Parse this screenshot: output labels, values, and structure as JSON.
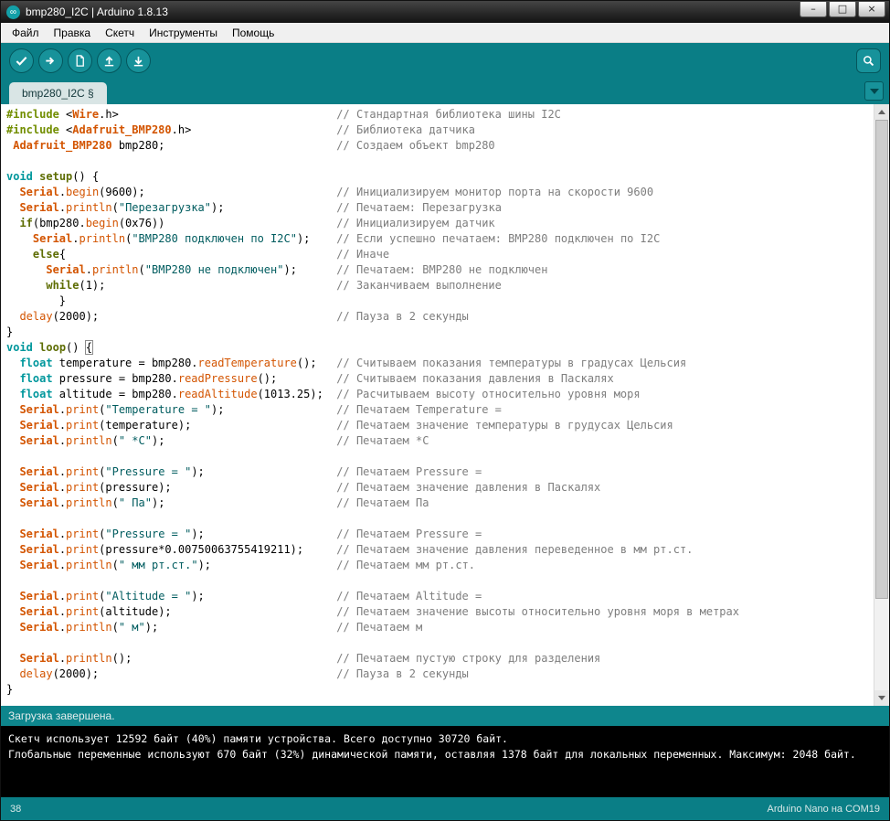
{
  "window": {
    "title": "bmp280_I2C | Arduino 1.8.13",
    "app_icon_glyph": "∞",
    "controls": {
      "minimize": "–",
      "maximize": "□",
      "close": "×"
    }
  },
  "menu": {
    "items": [
      {
        "name": "menu-file",
        "label": "Файл"
      },
      {
        "name": "menu-edit",
        "label": "Правка"
      },
      {
        "name": "menu-sketch",
        "label": "Скетч"
      },
      {
        "name": "menu-tools",
        "label": "Инструменты"
      },
      {
        "name": "menu-help",
        "label": "Помощь"
      }
    ]
  },
  "toolbar": {
    "buttons": [
      {
        "name": "verify-button",
        "icon": "check-icon"
      },
      {
        "name": "upload-button",
        "icon": "arrow-right-icon"
      },
      {
        "name": "new-sketch-button",
        "icon": "document-icon"
      },
      {
        "name": "open-button",
        "icon": "arrow-up-icon"
      },
      {
        "name": "save-button",
        "icon": "arrow-down-icon"
      }
    ],
    "serial_monitor": {
      "name": "serial-monitor-button",
      "icon": "magnifier-icon"
    }
  },
  "tabs": {
    "active_label": "bmp280_I2C §"
  },
  "editor": {
    "comment_column": 50,
    "lines": [
      {
        "seg": [
          [
            "pp",
            "#include"
          ],
          [
            "pl",
            " <"
          ],
          [
            "cls",
            "Wire"
          ],
          [
            "pl",
            ".h>"
          ]
        ],
        "cmt": "// Стандартная библиотека шины I2C"
      },
      {
        "seg": [
          [
            "pp",
            "#include"
          ],
          [
            "pl",
            " <"
          ],
          [
            "cls",
            "Adafruit_BMP280"
          ],
          [
            "pl",
            ".h>"
          ]
        ],
        "cmt": "// Библиотека датчика"
      },
      {
        "seg": [
          [
            "pl",
            " "
          ],
          [
            "cls",
            "Adafruit_BMP280"
          ],
          [
            "pl",
            " bmp280;"
          ]
        ],
        "cmt": "// Создаем объект bmp280"
      },
      {},
      {
        "seg": [
          [
            "kw",
            "void"
          ],
          [
            "pl",
            " "
          ],
          [
            "ctl",
            "setup"
          ],
          [
            "pl",
            "() {"
          ]
        ]
      },
      {
        "seg": [
          [
            "pl",
            "  "
          ],
          [
            "cls",
            "Serial"
          ],
          [
            "pl",
            "."
          ],
          [
            "fn",
            "begin"
          ],
          [
            "pl",
            "(9600);"
          ]
        ],
        "cmt": "// Инициализируем монитор порта на скорости 9600"
      },
      {
        "seg": [
          [
            "pl",
            "  "
          ],
          [
            "cls",
            "Serial"
          ],
          [
            "pl",
            "."
          ],
          [
            "fn",
            "println"
          ],
          [
            "pl",
            "("
          ],
          [
            "str",
            "\"Перезагрузка\""
          ],
          [
            "pl",
            ");"
          ]
        ],
        "cmt": "// Печатаем: Перезагрузка"
      },
      {
        "seg": [
          [
            "pl",
            "  "
          ],
          [
            "ctl",
            "if"
          ],
          [
            "pl",
            "(bmp280."
          ],
          [
            "fn",
            "begin"
          ],
          [
            "pl",
            "(0x76))"
          ]
        ],
        "cmt": "// Инициализируем датчик"
      },
      {
        "seg": [
          [
            "pl",
            "    "
          ],
          [
            "cls",
            "Serial"
          ],
          [
            "pl",
            "."
          ],
          [
            "fn",
            "println"
          ],
          [
            "pl",
            "("
          ],
          [
            "str",
            "\"BMP280 подключен по I2C\""
          ],
          [
            "pl",
            ");"
          ]
        ],
        "cmt": "// Если успешно печатаем: BMP280 подключен по I2C"
      },
      {
        "seg": [
          [
            "pl",
            "    "
          ],
          [
            "ctl",
            "else"
          ],
          [
            "pl",
            "{"
          ]
        ],
        "cmt": "// Иначе"
      },
      {
        "seg": [
          [
            "pl",
            "      "
          ],
          [
            "cls",
            "Serial"
          ],
          [
            "pl",
            "."
          ],
          [
            "fn",
            "println"
          ],
          [
            "pl",
            "("
          ],
          [
            "str",
            "\"BMP280 не подключен\""
          ],
          [
            "pl",
            ");"
          ]
        ],
        "cmt": "// Печатаем: BMP280 не подключен"
      },
      {
        "seg": [
          [
            "pl",
            "      "
          ],
          [
            "ctl",
            "while"
          ],
          [
            "pl",
            "(1);"
          ]
        ],
        "cmt": "// Заканчиваем выполнение"
      },
      {
        "seg": [
          [
            "pl",
            "        }"
          ]
        ]
      },
      {
        "seg": [
          [
            "pl",
            "  "
          ],
          [
            "fn",
            "delay"
          ],
          [
            "pl",
            "(2000);"
          ]
        ],
        "cmt": "// Пауза в 2 секунды"
      },
      {
        "seg": [
          [
            "pl",
            "}"
          ]
        ]
      },
      {
        "seg": [
          [
            "kw",
            "void"
          ],
          [
            "pl",
            " "
          ],
          [
            "ctl",
            "loop"
          ],
          [
            "pl",
            "() "
          ],
          [
            "bx",
            "{"
          ]
        ]
      },
      {
        "seg": [
          [
            "pl",
            "  "
          ],
          [
            "kw",
            "float"
          ],
          [
            "pl",
            " temperature = bmp280."
          ],
          [
            "fn",
            "readTemperature"
          ],
          [
            "pl",
            "();"
          ]
        ],
        "cmt": "// Считываем показания температуры в градусах Цельсия"
      },
      {
        "seg": [
          [
            "pl",
            "  "
          ],
          [
            "kw",
            "float"
          ],
          [
            "pl",
            " pressure = bmp280."
          ],
          [
            "fn",
            "readPressure"
          ],
          [
            "pl",
            "();"
          ]
        ],
        "cmt": "// Считываем показания давления в Паскалях"
      },
      {
        "seg": [
          [
            "pl",
            "  "
          ],
          [
            "kw",
            "float"
          ],
          [
            "pl",
            " altitude = bmp280."
          ],
          [
            "fn",
            "readAltitude"
          ],
          [
            "pl",
            "(1013.25);"
          ]
        ],
        "cmt": "// Расчитываем высоту относительно уровня моря"
      },
      {
        "seg": [
          [
            "pl",
            "  "
          ],
          [
            "cls",
            "Serial"
          ],
          [
            "pl",
            "."
          ],
          [
            "fn",
            "print"
          ],
          [
            "pl",
            "("
          ],
          [
            "str",
            "\"Temperature = \""
          ],
          [
            "pl",
            ");"
          ]
        ],
        "cmt": "// Печатаем Temperature ="
      },
      {
        "seg": [
          [
            "pl",
            "  "
          ],
          [
            "cls",
            "Serial"
          ],
          [
            "pl",
            "."
          ],
          [
            "fn",
            "print"
          ],
          [
            "pl",
            "(temperature);"
          ]
        ],
        "cmt": "// Печатаем значение температуры в грудусах Цельсия"
      },
      {
        "seg": [
          [
            "pl",
            "  "
          ],
          [
            "cls",
            "Serial"
          ],
          [
            "pl",
            "."
          ],
          [
            "fn",
            "println"
          ],
          [
            "pl",
            "("
          ],
          [
            "str",
            "\" *C\""
          ],
          [
            "pl",
            ");"
          ]
        ],
        "cmt": "// Печатаем *C"
      },
      {},
      {
        "seg": [
          [
            "pl",
            "  "
          ],
          [
            "cls",
            "Serial"
          ],
          [
            "pl",
            "."
          ],
          [
            "fn",
            "print"
          ],
          [
            "pl",
            "("
          ],
          [
            "str",
            "\"Pressure = \""
          ],
          [
            "pl",
            ");"
          ]
        ],
        "cmt": "// Печатаем Pressure ="
      },
      {
        "seg": [
          [
            "pl",
            "  "
          ],
          [
            "cls",
            "Serial"
          ],
          [
            "pl",
            "."
          ],
          [
            "fn",
            "print"
          ],
          [
            "pl",
            "(pressure);"
          ]
        ],
        "cmt": "// Печатаем значение давления в Паскалях"
      },
      {
        "seg": [
          [
            "pl",
            "  "
          ],
          [
            "cls",
            "Serial"
          ],
          [
            "pl",
            "."
          ],
          [
            "fn",
            "println"
          ],
          [
            "pl",
            "("
          ],
          [
            "str",
            "\" Па\""
          ],
          [
            "pl",
            ");"
          ]
        ],
        "cmt": "// Печатаем Па"
      },
      {},
      {
        "seg": [
          [
            "pl",
            "  "
          ],
          [
            "cls",
            "Serial"
          ],
          [
            "pl",
            "."
          ],
          [
            "fn",
            "print"
          ],
          [
            "pl",
            "("
          ],
          [
            "str",
            "\"Pressure = \""
          ],
          [
            "pl",
            ");"
          ]
        ],
        "cmt": "// Печатаем Pressure ="
      },
      {
        "seg": [
          [
            "pl",
            "  "
          ],
          [
            "cls",
            "Serial"
          ],
          [
            "pl",
            "."
          ],
          [
            "fn",
            "print"
          ],
          [
            "pl",
            "(pressure*0.00750063755419211);"
          ]
        ],
        "cmt": "// Печатаем значение давления переведенное в мм рт.ст."
      },
      {
        "seg": [
          [
            "pl",
            "  "
          ],
          [
            "cls",
            "Serial"
          ],
          [
            "pl",
            "."
          ],
          [
            "fn",
            "println"
          ],
          [
            "pl",
            "("
          ],
          [
            "str",
            "\" мм рт.ст.\""
          ],
          [
            "pl",
            ");"
          ]
        ],
        "cmt": "// Печатаем мм рт.ст."
      },
      {},
      {
        "seg": [
          [
            "pl",
            "  "
          ],
          [
            "cls",
            "Serial"
          ],
          [
            "pl",
            "."
          ],
          [
            "fn",
            "print"
          ],
          [
            "pl",
            "("
          ],
          [
            "str",
            "\"Altitude = \""
          ],
          [
            "pl",
            ");"
          ]
        ],
        "cmt": "// Печатаем Altitude ="
      },
      {
        "seg": [
          [
            "pl",
            "  "
          ],
          [
            "cls",
            "Serial"
          ],
          [
            "pl",
            "."
          ],
          [
            "fn",
            "print"
          ],
          [
            "pl",
            "(altitude);"
          ]
        ],
        "cmt": "// Печатаем значение высоты относительно уровня моря в метрах"
      },
      {
        "seg": [
          [
            "pl",
            "  "
          ],
          [
            "cls",
            "Serial"
          ],
          [
            "pl",
            "."
          ],
          [
            "fn",
            "println"
          ],
          [
            "pl",
            "("
          ],
          [
            "str",
            "\" м\""
          ],
          [
            "pl",
            ");"
          ]
        ],
        "cmt": "// Печатаем м"
      },
      {},
      {
        "seg": [
          [
            "pl",
            "  "
          ],
          [
            "cls",
            "Serial"
          ],
          [
            "pl",
            "."
          ],
          [
            "fn",
            "println"
          ],
          [
            "pl",
            "();"
          ]
        ],
        "cmt": "// Печатаем пустую строку для разделения"
      },
      {
        "seg": [
          [
            "pl",
            "  "
          ],
          [
            "fn",
            "delay"
          ],
          [
            "pl",
            "(2000);"
          ]
        ],
        "cmt": "// Пауза в 2 секунды"
      },
      {
        "seg": [
          [
            "pl",
            "}"
          ]
        ]
      }
    ]
  },
  "status": {
    "message": "Загрузка завершена."
  },
  "console": {
    "lines": [
      "Скетч использует 12592 байт (40%) памяти устройства. Всего доступно 30720 байт.",
      "Глобальные переменные используют 670 байт (32%) динамической памяти, оставляя 1378 байт для локальных переменных. Максимум: 2048 байт."
    ]
  },
  "footer": {
    "line_number": "38",
    "board_info": "Arduino Nano на COM19"
  },
  "colors": {
    "toolbar_teal": "#0A7E86",
    "button_teal": "#17929A",
    "status_teal": "#0E868D",
    "tab_bg": "#D9E5E5",
    "console_bg": "#000000",
    "keyword_teal": "#00979C",
    "keyword_olive": "#5E6D03",
    "function_orange": "#D35400",
    "preproc_green": "#728E00",
    "string_teal": "#005C5F",
    "comment_gray": "#7E7E7E"
  }
}
